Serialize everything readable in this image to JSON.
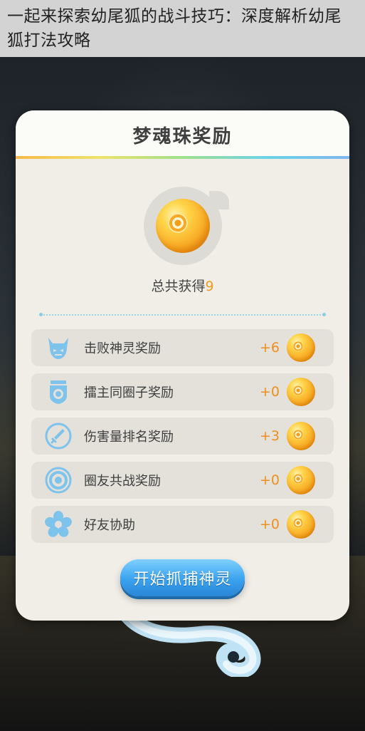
{
  "article": {
    "title": "一起来探索幼尾狐的战斗技巧：深度解析幼尾狐打法攻略"
  },
  "dialog": {
    "title": "梦魂珠奖励",
    "total_label": "总共获得",
    "total_value": "9",
    "rewards": [
      {
        "label": "击败神灵奖励",
        "value": "+6",
        "icon": "demon-mask-icon"
      },
      {
        "label": "擂主同圈子奖励",
        "value": "+0",
        "icon": "badge-shield-icon"
      },
      {
        "label": "伤害量排名奖励",
        "value": "+3",
        "icon": "sword-icon"
      },
      {
        "label": "圈友共战奖励",
        "value": "+0",
        "icon": "target-ring-icon"
      },
      {
        "label": "好友协助",
        "value": "+0",
        "icon": "flower-icon"
      }
    ],
    "start_button": "开始抓捕神灵"
  },
  "colors": {
    "accent_orange": "#f29a1e",
    "button_blue": "#3aa2ef",
    "icon_blue": "#7ec3ec"
  }
}
